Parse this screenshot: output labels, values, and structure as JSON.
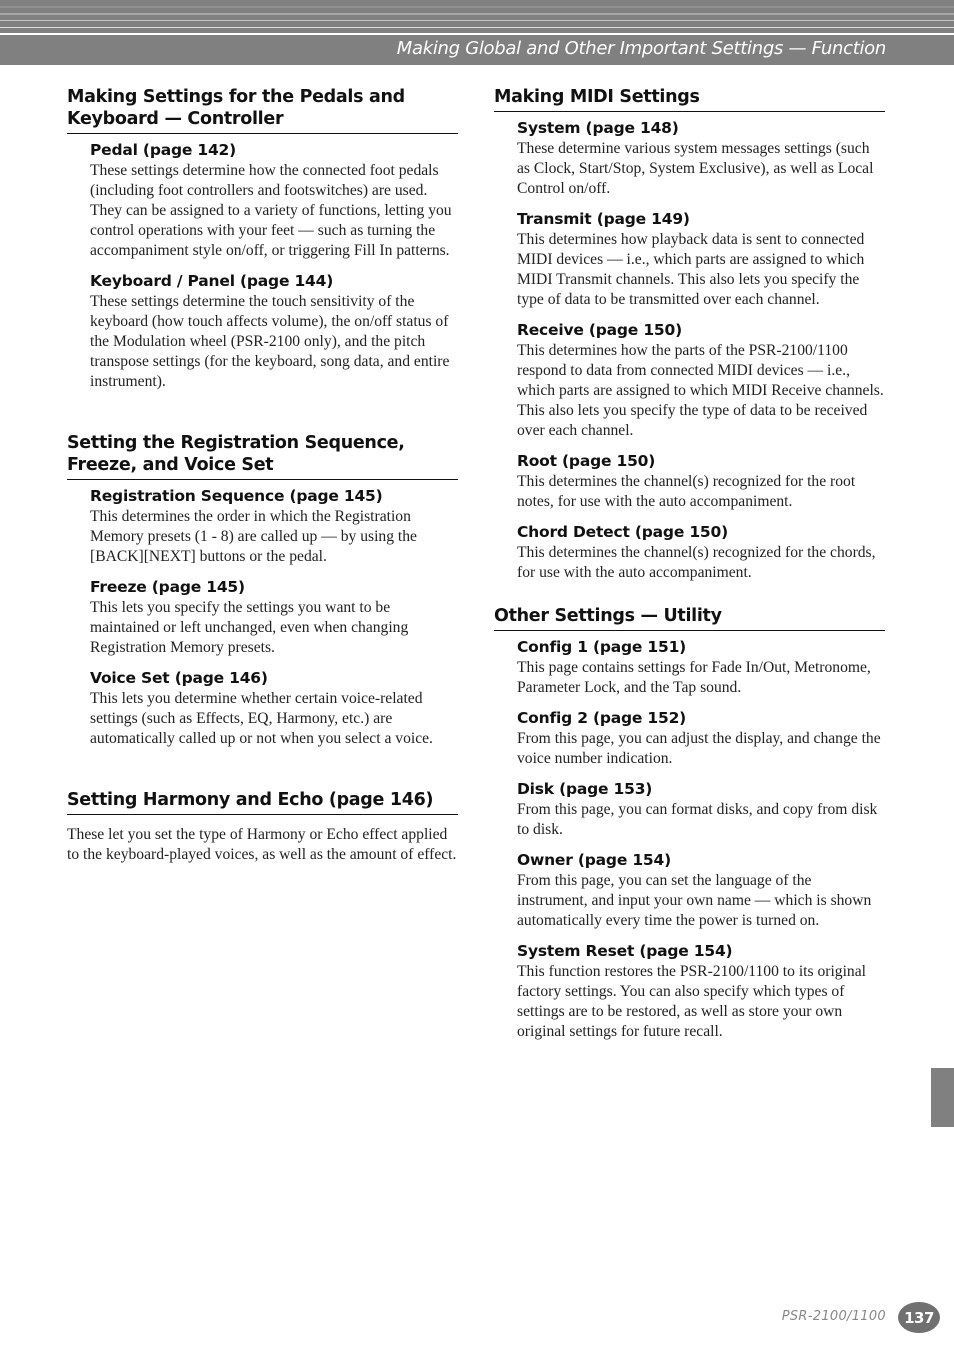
{
  "header": {
    "title": "Making Global and Other Important Settings — Function"
  },
  "left_column": {
    "sections": [
      {
        "title": "Making Settings for the Pedals and Keyboard — Controller",
        "entries": [
          {
            "title": "Pedal (page 142)",
            "body": "These settings determine how the connected foot pedals (including foot controllers and footswitches) are used. They can be assigned to a variety of functions, letting you control operations with your feet — such as turning the accompaniment style on/off, or triggering Fill In patterns."
          },
          {
            "title": "Keyboard / Panel (page 144)",
            "body": "These settings determine the touch sensitivity of the keyboard (how touch affects volume), the on/off status of the Modulation wheel (PSR-2100 only), and the pitch transpose settings (for the keyboard, song data, and entire instrument)."
          }
        ]
      },
      {
        "title": "Setting the Registration Sequence, Freeze, and Voice Set",
        "entries": [
          {
            "title": "Registration Sequence (page 145)",
            "body": "This determines the order in which the Registration Memory presets (1 - 8) are called up — by using the [BACK][NEXT] buttons or the pedal."
          },
          {
            "title": "Freeze (page 145)",
            "body": "This lets you specify the settings you want to be maintained or left unchanged, even when changing Registration Memory presets."
          },
          {
            "title": "Voice Set (page 146)",
            "body": "This lets you determine whether certain voice-related settings (such as Effects, EQ, Harmony, etc.) are automatically called up or not when you select a voice."
          }
        ]
      },
      {
        "title": "Setting Harmony and Echo (page 146)",
        "body": "These let you set the type of Harmony or Echo effect applied to the keyboard-played voices, as well as the amount of effect."
      }
    ]
  },
  "right_column": {
    "sections": [
      {
        "title": "Making MIDI Settings",
        "entries": [
          {
            "title": "System (page 148)",
            "body": "These determine various system messages settings (such as Clock, Start/Stop, System Exclusive), as well as Local Control on/off."
          },
          {
            "title": "Transmit (page 149)",
            "body": "This determines how playback data is sent to connected MIDI devices — i.e., which parts are assigned to which MIDI Transmit channels. This also lets you specify the type of data to be transmitted over each channel."
          },
          {
            "title": "Receive (page 150)",
            "body": "This determines how the parts of the PSR-2100/1100 respond to data from connected MIDI devices — i.e., which parts are assigned to which MIDI Receive channels. This also lets you specify the type of data to be received over each channel."
          },
          {
            "title": "Root (page 150)",
            "body": "This determines the channel(s) recognized for the root notes, for use with the auto accompaniment."
          },
          {
            "title": "Chord Detect (page 150)",
            "body": "This determines the channel(s) recognized for the chords, for use with the auto accompaniment."
          }
        ]
      },
      {
        "title": "Other Settings — Utility",
        "entries": [
          {
            "title": "Config 1 (page 151)",
            "body": "This page contains settings for Fade In/Out, Metronome, Parameter Lock, and the Tap sound."
          },
          {
            "title": "Config 2 (page 152)",
            "body": "From this page, you can adjust the display, and change the voice number indication."
          },
          {
            "title": "Disk (page 153)",
            "body": "From this page, you can format disks, and copy from disk to disk."
          },
          {
            "title": "Owner (page 154)",
            "body": "From this page, you can set the language of the instrument, and input your own name — which is shown automatically every time the power is turned on."
          },
          {
            "title": "System Reset (page 154)",
            "body": "This function restores the PSR-2100/1100 to its original factory settings. You can also specify which types of settings are to be restored, as well as store your own original settings for future recall."
          }
        ]
      }
    ]
  },
  "footer": {
    "model": "PSR-2100/1100",
    "page_number": "137"
  },
  "colors": {
    "header_band": "#808080",
    "side_tab": "#808080",
    "page_badge": "#707070"
  }
}
